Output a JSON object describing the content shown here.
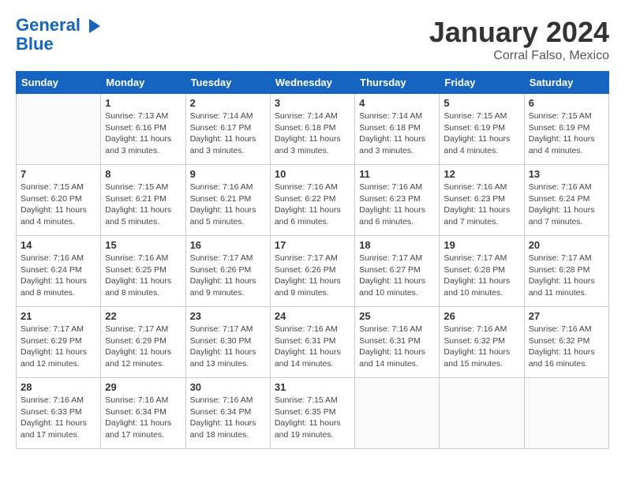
{
  "header": {
    "logo_line1": "General",
    "logo_line2": "Blue",
    "month": "January 2024",
    "location": "Corral Falso, Mexico"
  },
  "weekdays": [
    "Sunday",
    "Monday",
    "Tuesday",
    "Wednesday",
    "Thursday",
    "Friday",
    "Saturday"
  ],
  "weeks": [
    [
      {
        "day": "",
        "sunrise": "",
        "sunset": "",
        "daylight": ""
      },
      {
        "day": "1",
        "sunrise": "7:13 AM",
        "sunset": "6:16 PM",
        "daylight": "11 hours and 3 minutes."
      },
      {
        "day": "2",
        "sunrise": "7:14 AM",
        "sunset": "6:17 PM",
        "daylight": "11 hours and 3 minutes."
      },
      {
        "day": "3",
        "sunrise": "7:14 AM",
        "sunset": "6:18 PM",
        "daylight": "11 hours and 3 minutes."
      },
      {
        "day": "4",
        "sunrise": "7:14 AM",
        "sunset": "6:18 PM",
        "daylight": "11 hours and 3 minutes."
      },
      {
        "day": "5",
        "sunrise": "7:15 AM",
        "sunset": "6:19 PM",
        "daylight": "11 hours and 4 minutes."
      },
      {
        "day": "6",
        "sunrise": "7:15 AM",
        "sunset": "6:19 PM",
        "daylight": "11 hours and 4 minutes."
      }
    ],
    [
      {
        "day": "7",
        "sunrise": "7:15 AM",
        "sunset": "6:20 PM",
        "daylight": "11 hours and 4 minutes."
      },
      {
        "day": "8",
        "sunrise": "7:15 AM",
        "sunset": "6:21 PM",
        "daylight": "11 hours and 5 minutes."
      },
      {
        "day": "9",
        "sunrise": "7:16 AM",
        "sunset": "6:21 PM",
        "daylight": "11 hours and 5 minutes."
      },
      {
        "day": "10",
        "sunrise": "7:16 AM",
        "sunset": "6:22 PM",
        "daylight": "11 hours and 6 minutes."
      },
      {
        "day": "11",
        "sunrise": "7:16 AM",
        "sunset": "6:23 PM",
        "daylight": "11 hours and 6 minutes."
      },
      {
        "day": "12",
        "sunrise": "7:16 AM",
        "sunset": "6:23 PM",
        "daylight": "11 hours and 7 minutes."
      },
      {
        "day": "13",
        "sunrise": "7:16 AM",
        "sunset": "6:24 PM",
        "daylight": "11 hours and 7 minutes."
      }
    ],
    [
      {
        "day": "14",
        "sunrise": "7:16 AM",
        "sunset": "6:24 PM",
        "daylight": "11 hours and 8 minutes."
      },
      {
        "day": "15",
        "sunrise": "7:16 AM",
        "sunset": "6:25 PM",
        "daylight": "11 hours and 8 minutes."
      },
      {
        "day": "16",
        "sunrise": "7:17 AM",
        "sunset": "6:26 PM",
        "daylight": "11 hours and 9 minutes."
      },
      {
        "day": "17",
        "sunrise": "7:17 AM",
        "sunset": "6:26 PM",
        "daylight": "11 hours and 9 minutes."
      },
      {
        "day": "18",
        "sunrise": "7:17 AM",
        "sunset": "6:27 PM",
        "daylight": "11 hours and 10 minutes."
      },
      {
        "day": "19",
        "sunrise": "7:17 AM",
        "sunset": "6:28 PM",
        "daylight": "11 hours and 10 minutes."
      },
      {
        "day": "20",
        "sunrise": "7:17 AM",
        "sunset": "6:28 PM",
        "daylight": "11 hours and 11 minutes."
      }
    ],
    [
      {
        "day": "21",
        "sunrise": "7:17 AM",
        "sunset": "6:29 PM",
        "daylight": "11 hours and 12 minutes."
      },
      {
        "day": "22",
        "sunrise": "7:17 AM",
        "sunset": "6:29 PM",
        "daylight": "11 hours and 12 minutes."
      },
      {
        "day": "23",
        "sunrise": "7:17 AM",
        "sunset": "6:30 PM",
        "daylight": "11 hours and 13 minutes."
      },
      {
        "day": "24",
        "sunrise": "7:16 AM",
        "sunset": "6:31 PM",
        "daylight": "11 hours and 14 minutes."
      },
      {
        "day": "25",
        "sunrise": "7:16 AM",
        "sunset": "6:31 PM",
        "daylight": "11 hours and 14 minutes."
      },
      {
        "day": "26",
        "sunrise": "7:16 AM",
        "sunset": "6:32 PM",
        "daylight": "11 hours and 15 minutes."
      },
      {
        "day": "27",
        "sunrise": "7:16 AM",
        "sunset": "6:32 PM",
        "daylight": "11 hours and 16 minutes."
      }
    ],
    [
      {
        "day": "28",
        "sunrise": "7:16 AM",
        "sunset": "6:33 PM",
        "daylight": "11 hours and 17 minutes."
      },
      {
        "day": "29",
        "sunrise": "7:16 AM",
        "sunset": "6:34 PM",
        "daylight": "11 hours and 17 minutes."
      },
      {
        "day": "30",
        "sunrise": "7:16 AM",
        "sunset": "6:34 PM",
        "daylight": "11 hours and 18 minutes."
      },
      {
        "day": "31",
        "sunrise": "7:15 AM",
        "sunset": "6:35 PM",
        "daylight": "11 hours and 19 minutes."
      },
      {
        "day": "",
        "sunrise": "",
        "sunset": "",
        "daylight": ""
      },
      {
        "day": "",
        "sunrise": "",
        "sunset": "",
        "daylight": ""
      },
      {
        "day": "",
        "sunrise": "",
        "sunset": "",
        "daylight": ""
      }
    ]
  ]
}
